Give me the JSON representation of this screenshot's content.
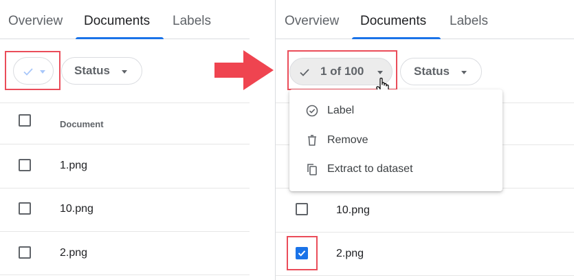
{
  "left_panel": {
    "tabs": [
      {
        "label": "Overview"
      },
      {
        "label": "Documents"
      },
      {
        "label": "Labels"
      }
    ],
    "status_chip": {
      "label": "Status"
    },
    "table": {
      "header": "Document",
      "rows": [
        {
          "name": "1.png",
          "checked": false
        },
        {
          "name": "10.png",
          "checked": false
        },
        {
          "name": "2.png",
          "checked": false
        }
      ]
    }
  },
  "right_panel": {
    "tabs": [
      {
        "label": "Overview"
      },
      {
        "label": "Documents"
      },
      {
        "label": "Labels"
      }
    ],
    "selection_chip": {
      "label": "1 of 100"
    },
    "status_chip": {
      "label": "Status"
    },
    "menu": {
      "items": [
        {
          "label": "Label",
          "icon": "check-circle-icon"
        },
        {
          "label": "Remove",
          "icon": "trash-icon"
        },
        {
          "label": "Extract to dataset",
          "icon": "copy-icon"
        }
      ]
    },
    "table": {
      "rows": [
        {
          "name": "10.png",
          "checked": false
        },
        {
          "name": "2.png",
          "checked": true
        }
      ]
    }
  },
  "colors": {
    "accent": "#1a73e8",
    "highlight": "#ea4c59",
    "arrow": "#ef4450",
    "border": "#dadce0",
    "muted_text": "#5f6368"
  }
}
